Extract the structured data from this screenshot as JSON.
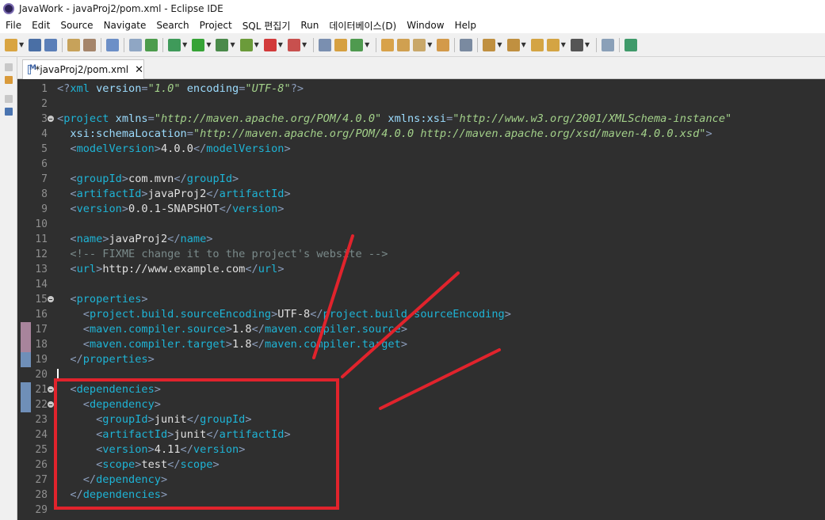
{
  "window": {
    "title": "JavaWork - javaProj2/pom.xml - Eclipse IDE"
  },
  "menu": [
    "File",
    "Edit",
    "Source",
    "Navigate",
    "Search",
    "Project",
    "SQL 편집기",
    "Run",
    "데이터베이스(D)",
    "Window",
    "Help"
  ],
  "toolbar": {
    "icons": [
      "new-icon",
      "save-icon",
      "save-all-icon",
      "print-icon",
      "properties-icon",
      "skip-breakpoints-icon",
      "debug-icon",
      "run-icon",
      "coverage-icon",
      "external-tools-icon",
      "stop-icon",
      "open-type-icon",
      "open-resource-icon",
      "search-icon",
      "annotation-icon",
      "prev-edit-icon",
      "back-icon",
      "forward-icon",
      "pin-icon"
    ]
  },
  "editor": {
    "tab_label": "*javaProj2/pom.xml",
    "tab_close": "✕"
  },
  "code_lines": [
    {
      "n": "1",
      "text": "<?xml version=\"1.0\" encoding=\"UTF-8\"?>"
    },
    {
      "n": "2",
      "text": ""
    },
    {
      "n": "3",
      "text": "<project xmlns=\"http://maven.apache.org/POM/4.0.0\" xmlns:xsi=\"http://www.w3.org/2001/XMLSchema-instance\""
    },
    {
      "n": "4",
      "text": "  xsi:schemaLocation=\"http://maven.apache.org/POM/4.0.0 http://maven.apache.org/xsd/maven-4.0.0.xsd\">"
    },
    {
      "n": "5",
      "text": "  <modelVersion>4.0.0</modelVersion>"
    },
    {
      "n": "6",
      "text": ""
    },
    {
      "n": "7",
      "text": "  <groupId>com.mvn</groupId>"
    },
    {
      "n": "8",
      "text": "  <artifactId>javaProj2</artifactId>"
    },
    {
      "n": "9",
      "text": "  <version>0.0.1-SNAPSHOT</version>"
    },
    {
      "n": "10",
      "text": ""
    },
    {
      "n": "11",
      "text": "  <name>javaProj2</name>"
    },
    {
      "n": "12",
      "text": "  <!-- FIXME change it to the project's website -->"
    },
    {
      "n": "13",
      "text": "  <url>http://www.example.com</url>"
    },
    {
      "n": "14",
      "text": ""
    },
    {
      "n": "15",
      "text": "  <properties>"
    },
    {
      "n": "16",
      "text": "    <project.build.sourceEncoding>UTF-8</project.build.sourceEncoding>"
    },
    {
      "n": "17",
      "text": "    <maven.compiler.source>1.8</maven.compiler.source>"
    },
    {
      "n": "18",
      "text": "    <maven.compiler.target>1.8</maven.compiler.target>"
    },
    {
      "n": "19",
      "text": "  </properties>"
    },
    {
      "n": "20",
      "text": ""
    },
    {
      "n": "21",
      "text": "  <dependencies>"
    },
    {
      "n": "22",
      "text": "    <dependency>"
    },
    {
      "n": "23",
      "text": "      <groupId>junit</groupId>"
    },
    {
      "n": "24",
      "text": "      <artifactId>junit</artifactId>"
    },
    {
      "n": "25",
      "text": "      <version>4.11</version>"
    },
    {
      "n": "26",
      "text": "      <scope>test</scope>"
    },
    {
      "n": "27",
      "text": "    </dependency>"
    },
    {
      "n": "28",
      "text": "  </dependencies>"
    },
    {
      "n": "29",
      "text": ""
    }
  ],
  "colors": {
    "editor_bg": "#2f2f2f",
    "tag": "#1eb4d6",
    "attribute": "#9cdcfe",
    "string": "#a3d18a",
    "comment": "#7a8a8a",
    "annotation_red": "#e1232c"
  }
}
